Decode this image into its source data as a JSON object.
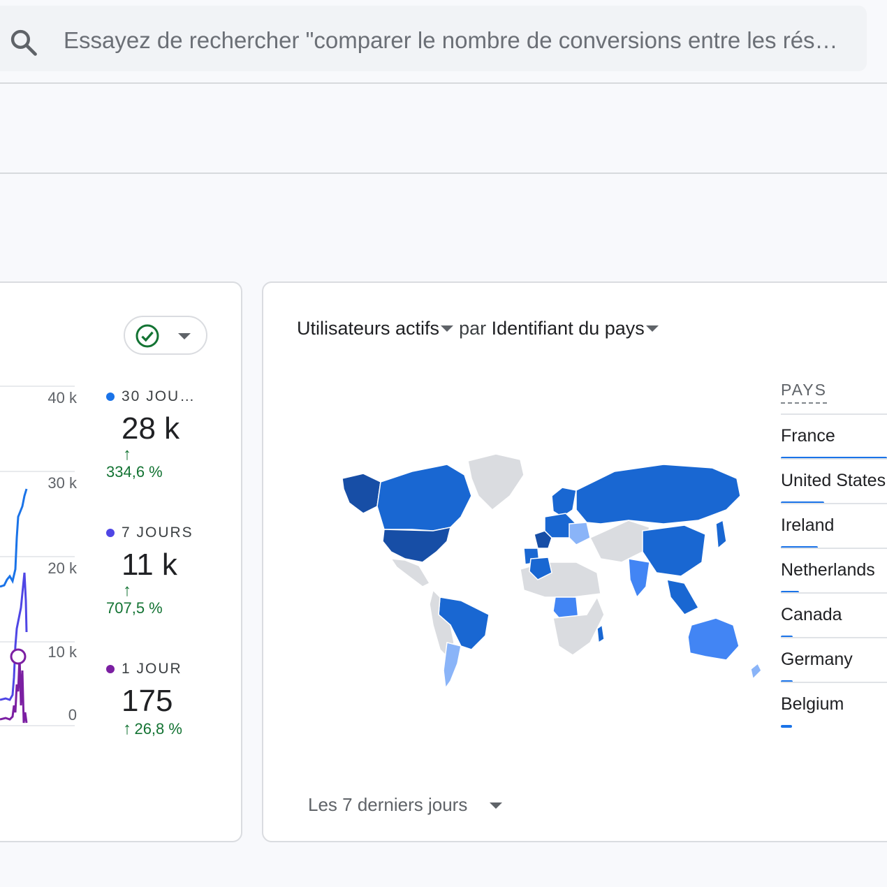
{
  "search": {
    "placeholder": "Essayez de rechercher \"comparer le nombre de conversions entre les rés…"
  },
  "realtime_card": {
    "y_axis": [
      "40 k",
      "30 k",
      "20 k",
      "10 k",
      "0"
    ],
    "stats": [
      {
        "label": "30 JOU…",
        "value": "28 k",
        "delta": "334,6 %",
        "color": "#1a73e8"
      },
      {
        "label": "7 JOURS",
        "value": "11 k",
        "delta": "707,5 %",
        "color": "#4f46e5"
      },
      {
        "label": "1 JOUR",
        "value": "175",
        "delta": "26,8 %",
        "color": "#7b1fa2"
      }
    ]
  },
  "map_card": {
    "metric": "Utilisateurs actifs",
    "connector": "par",
    "dimension": "Identifiant du pays",
    "legend_header": "PAYS",
    "countries": [
      {
        "name": "France",
        "share": 1.0
      },
      {
        "name": "United States",
        "share": 0.4
      },
      {
        "name": "Ireland",
        "share": 0.35
      },
      {
        "name": "Netherlands",
        "share": 0.17
      },
      {
        "name": "Canada",
        "share": 0.11
      },
      {
        "name": "Germany",
        "share": 0.11
      },
      {
        "name": "Belgium",
        "share": 0.1
      }
    ],
    "date_range": "Les 7 derniers jours"
  },
  "colors": {
    "accent": "#1a73e8",
    "positive": "#137333",
    "map_dark": "#174ea6",
    "map_mid": "#1967d2",
    "map_light": "#8ab4f8",
    "map_none": "#dadce0"
  }
}
